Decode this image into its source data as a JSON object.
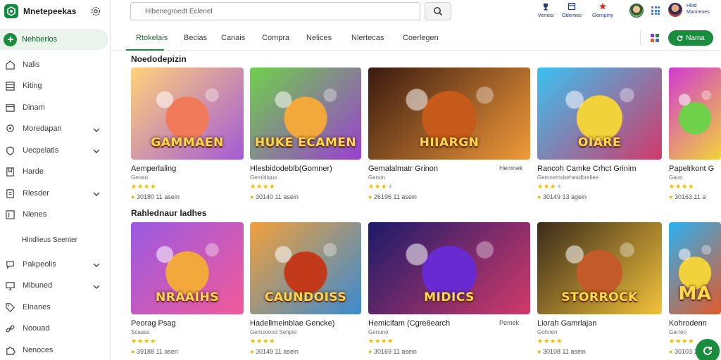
{
  "brand": {
    "name": "Mnetepeekas"
  },
  "sidebar": {
    "active": {
      "label": "Nehberlos"
    },
    "items": [
      {
        "label": "Nalis",
        "icon": "home-icon",
        "chevron": false
      },
      {
        "label": "Kiting",
        "icon": "grid-icon",
        "chevron": false
      },
      {
        "label": "Dinam",
        "icon": "window-icon",
        "chevron": false
      },
      {
        "label": "Moredapan",
        "icon": "map-pin-icon",
        "chevron": true
      },
      {
        "label": "Uecpelatis",
        "icon": "shield-icon",
        "chevron": true
      },
      {
        "label": "Harde",
        "icon": "bookmark-icon",
        "chevron": false
      },
      {
        "label": "Rlesder",
        "icon": "layers-icon",
        "chevron": true
      },
      {
        "label": "Nlenes",
        "icon": "list-icon",
        "chevron": false
      },
      {
        "label": "Hlndlieus Seenter",
        "icon": "",
        "chevron": false
      },
      {
        "label": "Pakpeolis",
        "icon": "chat-icon",
        "chevron": true
      },
      {
        "label": "Mlbuned",
        "icon": "monitor-icon",
        "chevron": true
      },
      {
        "label": "Elnanes",
        "icon": "tag-icon",
        "chevron": false
      },
      {
        "label": "Noouad",
        "icon": "link-icon",
        "chevron": false
      },
      {
        "label": "Nenoces",
        "icon": "puzzle-icon",
        "chevron": false
      }
    ]
  },
  "header": {
    "search_placeholder": "Hlbenegroedt Eclenel",
    "buttons": [
      {
        "label": "Vemes",
        "icon": "trophy-icon"
      },
      {
        "label": "Odemes",
        "icon": "calendar-icon"
      },
      {
        "label": "Gempiny",
        "icon": "flag-icon"
      }
    ],
    "user_lines": [
      "Hlod",
      "Mannenes"
    ]
  },
  "tabs": {
    "items": [
      "Rtokelais",
      "Becias",
      "Canais",
      "Compra",
      "Nelices",
      "Nlertecas",
      "Coerlegen"
    ],
    "active_index": 0,
    "cta_label": "Nama"
  },
  "sections": [
    {
      "title": "Noedodepizin",
      "cards": [
        {
          "art_text": "GAMMAEN",
          "title": "Aemperlaling",
          "sub": "Geneo",
          "stars": 4,
          "rating": "30180",
          "meta": "11 asein",
          "tag": "",
          "colors": [
            "#ffd27a",
            "#f07a5a",
            "#a35ad6"
          ]
        },
        {
          "art_text": "HUKE ECAMEN",
          "title": "Hlesbidodeblb(Gomner)",
          "sub": "Gembliquo",
          "stars": 4,
          "rating": "30140",
          "meta": "11 asein",
          "tag": "",
          "colors": [
            "#6fd14a",
            "#f2a83a",
            "#9a3fd1"
          ]
        },
        {
          "art_text": "HIIARGN",
          "title": "Gemalalmatr Grinon",
          "sub": "Genon",
          "stars": 3,
          "rating": "26196",
          "meta": "11 asein",
          "tag": "Hemnek",
          "colors": [
            "#3a1a10",
            "#c65a1a",
            "#f29a3a"
          ]
        },
        {
          "art_text": "OIARE",
          "title": "Rancoh Camke Crhct Grinim",
          "sub": "Gemnemsbehesdbreliee",
          "stars": 3,
          "rating": "30149",
          "meta": "13 agein",
          "tag": "",
          "colors": [
            "#3ac2f2",
            "#f2d23a",
            "#d13a6a"
          ]
        },
        {
          "art_text": "",
          "title": "Papelrkont G",
          "sub": "Gaoo",
          "stars": 4,
          "rating": "30163",
          "meta": "11 a",
          "tag": "",
          "colors": [
            "#d13ad1",
            "#6fd14a",
            "#f2d23a"
          ]
        }
      ]
    },
    {
      "title": "Rahlednaur ladhes",
      "cards": [
        {
          "art_text": "NRAAIHS",
          "title": "Peorag Psag",
          "sub": "Scaaso",
          "stars": 4,
          "rating": "39188",
          "meta": "11 asen",
          "tag": "",
          "colors": [
            "#9a5ae2",
            "#f2a83a",
            "#f25a9a"
          ]
        },
        {
          "art_text": "CAUNDOISS",
          "title": "Hadellmeinblae Gencke)",
          "sub": "Gemzeond Senpie",
          "stars": 4,
          "rating": "30149",
          "meta": "11 asein",
          "tag": "",
          "colors": [
            "#f2a03a",
            "#c23a1a",
            "#3a8ad2"
          ]
        },
        {
          "art_text": "MIDICS",
          "title": "Hemicifam (Cgre8earch",
          "sub": "Genuno",
          "stars": 4,
          "rating": "30169",
          "meta": "11 asein",
          "tag": "Pemek",
          "colors": [
            "#1a1a6a",
            "#6a2ad2",
            "#d23a6a"
          ]
        },
        {
          "art_text": "STORROCK",
          "title": "Liorah Gamrlajan",
          "sub": "Gohnen",
          "stars": 4,
          "rating": "30108",
          "meta": "11 asein",
          "tag": "",
          "colors": [
            "#3a2a1a",
            "#c25a2a",
            "#f2c23a"
          ]
        },
        {
          "art_text": "MA",
          "title": "Kohrodenn",
          "sub": "Garreo",
          "stars": 4,
          "rating": "30103",
          "meta": "11",
          "tag": "",
          "colors": [
            "#2ab2f2",
            "#f2d23a",
            "#e25a2a"
          ]
        }
      ]
    }
  ]
}
